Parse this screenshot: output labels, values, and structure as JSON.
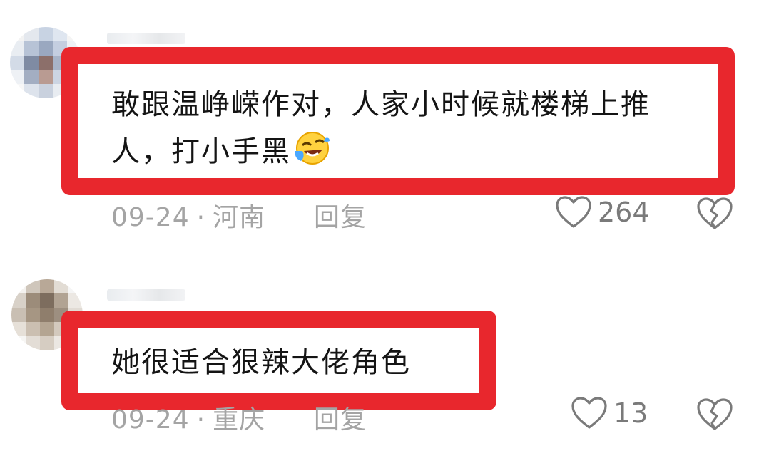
{
  "comments": [
    {
      "text_line1": "敢跟温峥嵘作对，人家小时候就楼梯上推",
      "text_line2": "人，打小手黑",
      "emoji": "laughing-crying-emoji",
      "date": "09-24",
      "location": "河南",
      "reply_label": "回复",
      "likes": "264"
    },
    {
      "text_line1": "她很适合狠辣大佬角色",
      "date": "09-24",
      "location": "重庆",
      "reply_label": "回复",
      "likes": "13"
    }
  ],
  "separator": "·",
  "icons": {
    "like": "heart-outline-icon",
    "dislike": "broken-heart-icon"
  },
  "colors": {
    "highlight_border": "#e8272d",
    "meta_text": "#a4a4a4",
    "comment_text": "#141414"
  }
}
